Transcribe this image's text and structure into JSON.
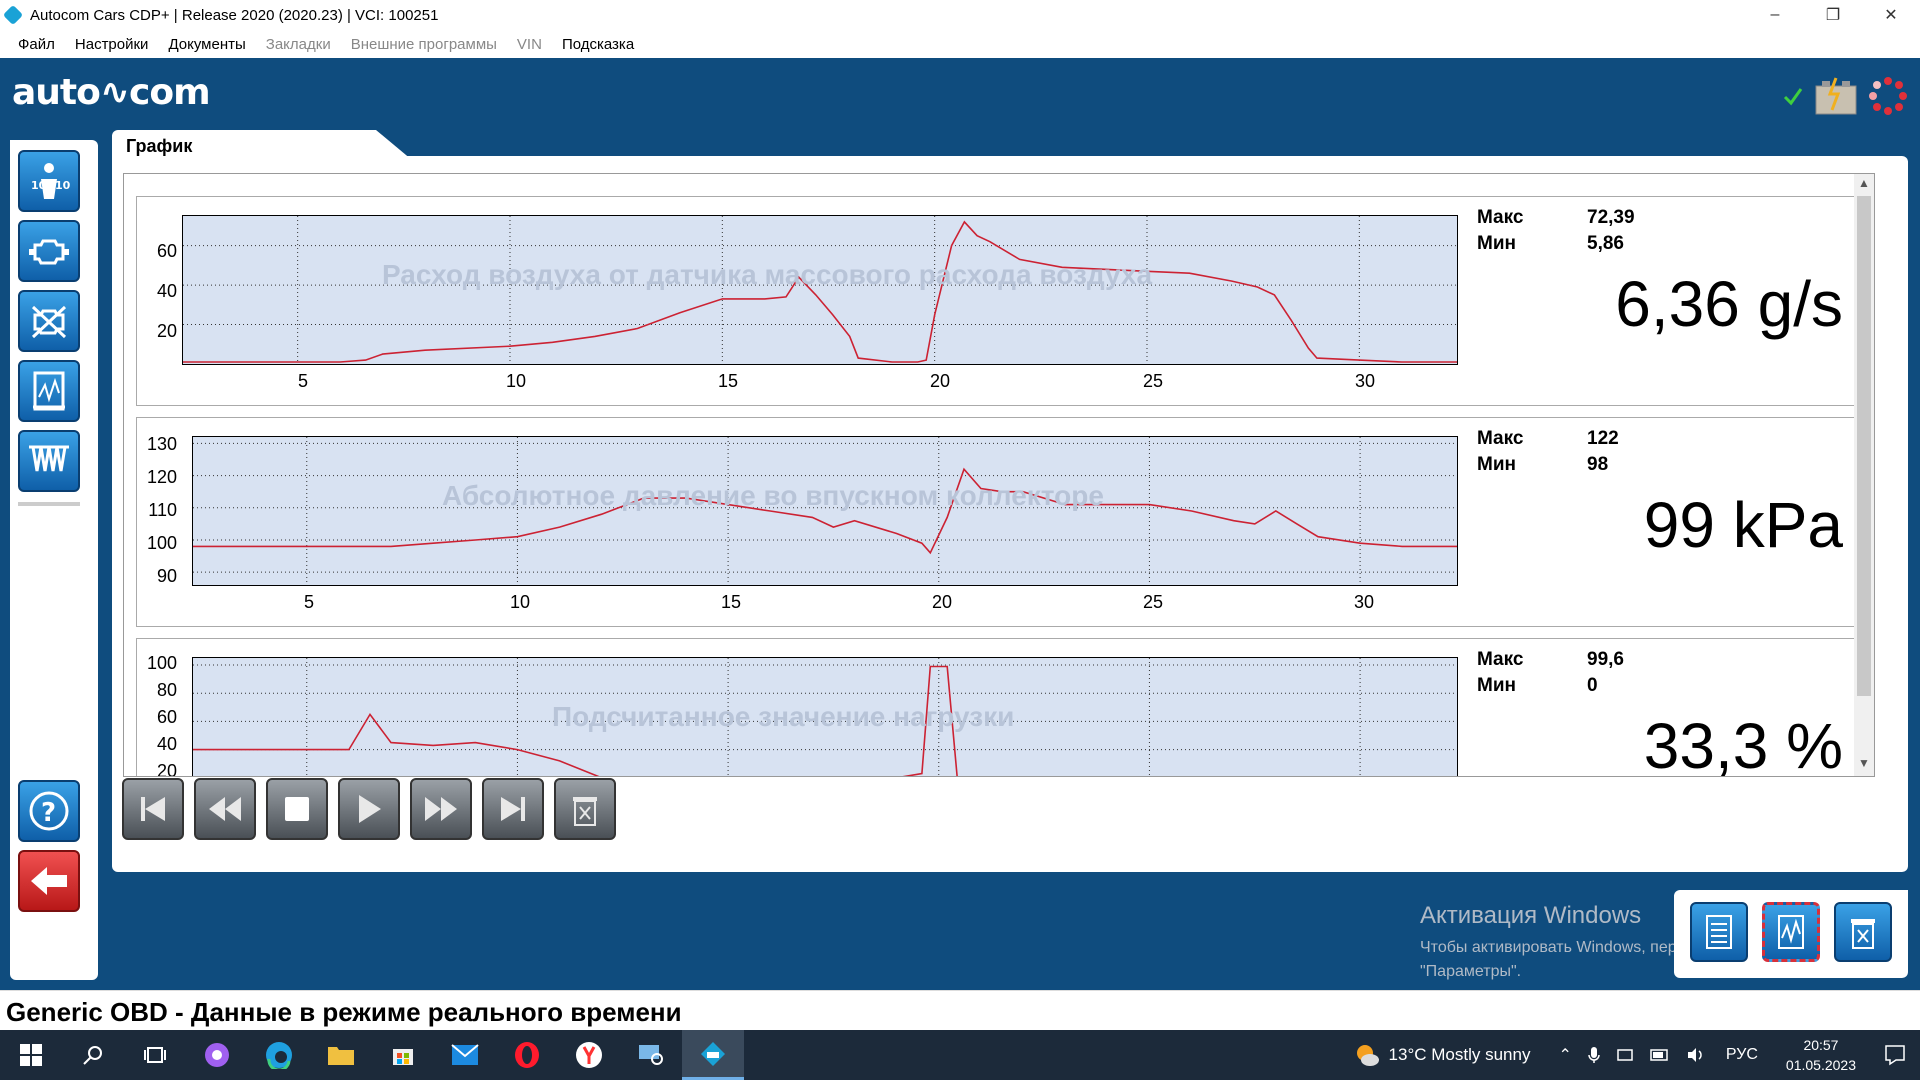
{
  "window": {
    "title": "Autocom Cars CDP+ |  Release 2020 (2020.23)  |  VCI: 100251",
    "minimize": "–",
    "restore": "❐",
    "close": "✕"
  },
  "menu": [
    {
      "label": "Файл",
      "enabled": true
    },
    {
      "label": "Настройки",
      "enabled": true
    },
    {
      "label": "Документы",
      "enabled": true
    },
    {
      "label": "Закладки",
      "enabled": false
    },
    {
      "label": "Внешние программы",
      "enabled": false
    },
    {
      "label": "VIN",
      "enabled": false
    },
    {
      "label": "Подсказка",
      "enabled": true
    }
  ],
  "logo": "auto∿com",
  "tab_label": "График",
  "charts": [
    {
      "title": "Расход воздуха от датчика массового расхода воздуха",
      "max_label": "Макс",
      "max": "72,39",
      "min_label": "Мин",
      "min": "5,86",
      "value": "6,36 g/s",
      "yticks": [
        "60",
        "40",
        "20"
      ],
      "xticks": [
        "5",
        "10",
        "15",
        "20",
        "25",
        "30"
      ]
    },
    {
      "title": "Абсолютное давление во впускном коллекторе",
      "max_label": "Макс",
      "max": "122",
      "min_label": "Мин",
      "min": "98",
      "value": "99 kPa",
      "yticks": [
        "130",
        "120",
        "110",
        "100",
        "90"
      ],
      "xticks": [
        "5",
        "10",
        "15",
        "20",
        "25",
        "30"
      ]
    },
    {
      "title": "Подсчитанное значение нагрузки",
      "max_label": "Макс",
      "max": "99,6",
      "min_label": "Мин",
      "min": "0",
      "value": "33,3 %",
      "yticks": [
        "100",
        "80",
        "60",
        "40",
        "20"
      ],
      "xticks": []
    }
  ],
  "chart_data": [
    {
      "type": "line",
      "title": "Расход воздуха от датчика массового расхода воздуха",
      "xlim": [
        2.3,
        32.3
      ],
      "ylim": [
        0,
        75
      ],
      "color": "#cc2233",
      "x": [
        2.3,
        4,
        6,
        6.6,
        7,
        8,
        10,
        11,
        12,
        13,
        14,
        15,
        16,
        16.5,
        16.8,
        17.2,
        17.6,
        18,
        18.2,
        19,
        19.6,
        19.8,
        20,
        20.4,
        20.7,
        21,
        21.3,
        22,
        23,
        24,
        25,
        26,
        27,
        27.6,
        28,
        28.4,
        28.8,
        29,
        30,
        31,
        32.3
      ],
      "y": [
        1,
        1,
        1,
        2,
        5,
        7,
        9,
        11,
        14,
        18,
        26,
        33,
        33,
        34,
        44,
        35,
        25,
        14,
        3,
        1,
        1,
        2,
        25,
        60,
        72,
        65,
        62,
        53,
        49,
        48,
        47,
        46,
        42,
        39,
        35,
        22,
        8,
        3,
        2,
        1,
        1
      ]
    },
    {
      "type": "line",
      "title": "Абсолютное давление во впускном коллекторе",
      "xlim": [
        2.3,
        32.3
      ],
      "ylim": [
        86,
        132
      ],
      "color": "#cc2233",
      "x": [
        2.3,
        4,
        6,
        7,
        8,
        9,
        10,
        11,
        12,
        13,
        14,
        15,
        16,
        17,
        17.5,
        18,
        19,
        19.6,
        19.8,
        20.2,
        20.6,
        21,
        21.5,
        22,
        23,
        24,
        25,
        26,
        27,
        27.5,
        28,
        28.5,
        29,
        30,
        31,
        32.3
      ],
      "y": [
        98,
        98,
        98,
        98,
        99,
        100,
        101,
        104,
        108,
        113,
        113,
        111,
        109,
        107,
        104,
        106,
        102,
        99,
        96,
        107,
        122,
        116,
        115,
        115,
        111,
        111,
        111,
        109,
        106,
        105,
        109,
        105,
        101,
        99,
        98,
        98
      ]
    },
    {
      "type": "line",
      "title": "Подсчитанное значение нагрузки",
      "xlim": [
        2.3,
        32.3
      ],
      "ylim": [
        0,
        105
      ],
      "color": "#cc2233",
      "x": [
        2.3,
        4,
        6,
        6.5,
        7,
        8,
        9,
        10,
        11,
        12,
        13,
        14,
        15,
        16,
        17,
        18,
        19,
        19.6,
        19.8,
        20.2,
        20.5,
        21,
        22,
        23,
        24,
        25,
        26,
        27,
        28,
        29,
        30,
        31,
        32.3
      ],
      "y": [
        40,
        40,
        40,
        65,
        45,
        43,
        45,
        40,
        32,
        20,
        10,
        5,
        3,
        2,
        1,
        1,
        20,
        23,
        99,
        99,
        0,
        0,
        0,
        0,
        0,
        0,
        0,
        0,
        0,
        13,
        15,
        16,
        17
      ]
    }
  ],
  "activation": {
    "title": "Активация Windows",
    "line1": "Чтобы активировать Windows, перейдите в раздел",
    "line2": "\"Параметры\"."
  },
  "status": "Generic OBD - Данные в режиме реального времени",
  "taskbar": {
    "weather": "13°C  Mostly sunny",
    "lang": "РУС",
    "time": "20:57",
    "date": "01.05.2023"
  },
  "colors": {
    "app_bg": "#0f4c7e",
    "plot_bg": "#d8e2f2",
    "trace": "#cc2233"
  }
}
